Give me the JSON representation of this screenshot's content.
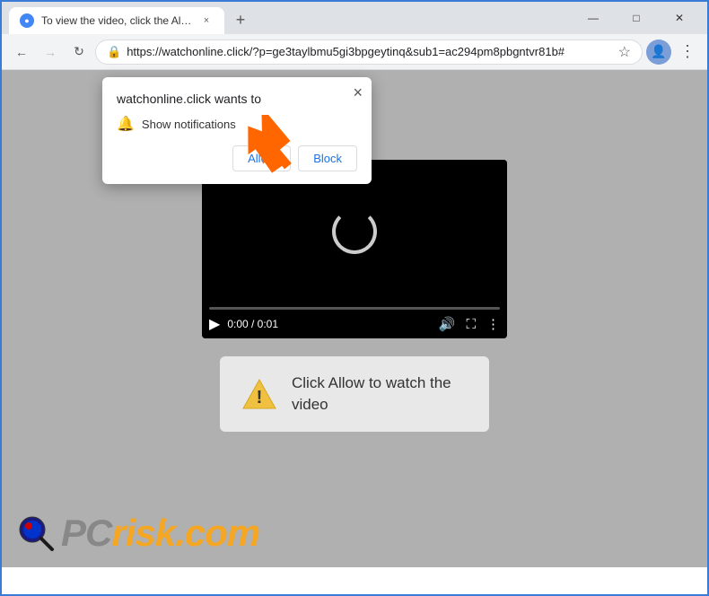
{
  "window": {
    "title": "To view the video, click the Allow...",
    "favicon": "●",
    "tab_close": "×",
    "new_tab": "+"
  },
  "addressbar": {
    "url": "https://watchonline.click/?p=ge3taylbmu5gi3bpgeytinq&sub1=ac294pm8pbgntvr81b#",
    "lock_icon": "🔒",
    "back_enabled": true,
    "forward_enabled": true
  },
  "nav": {
    "back": "←",
    "forward": "→",
    "reload": "↻",
    "star": "☆",
    "profile": "👤",
    "menu": "⋮"
  },
  "popup": {
    "title": "watchonline.click wants to",
    "description": "Show notifications",
    "close": "×",
    "allow_label": "Allow",
    "block_label": "Block"
  },
  "notification": {
    "text": "Click Allow to watch the video"
  },
  "video": {
    "time": "0:00 / 0:01"
  },
  "pcrisk": {
    "text_gray": "PC",
    "text_orange": "risk.com"
  },
  "colors": {
    "accent": "#1a73e8",
    "orange": "#f5a623",
    "warning_yellow": "#f0c040"
  }
}
